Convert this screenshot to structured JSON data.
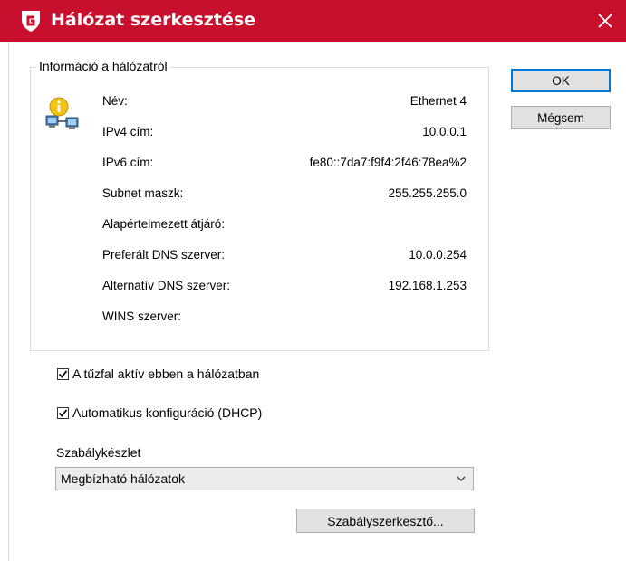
{
  "window": {
    "title": "Hálózat szerkesztése",
    "accent_color": "#c8102e",
    "logo_icon": "gdata-shield-icon",
    "close_icon": "close-icon"
  },
  "info_group": {
    "legend": "Információ a hálózatról",
    "icon": "network-info-icon",
    "rows": [
      {
        "label": "Név:",
        "value": "Ethernet 4"
      },
      {
        "label": "IPv4 cím:",
        "value": "10.0.0.1"
      },
      {
        "label": "IPv6 cím:",
        "value": "fe80::7da7:f9f4:2f46:78ea%2"
      },
      {
        "label": "Subnet maszk:",
        "value": "255.255.255.0"
      },
      {
        "label": "Alapértelmezett átjáró:",
        "value": ""
      },
      {
        "label": "Preferált DNS szerver:",
        "value": "10.0.0.254"
      },
      {
        "label": "Alternatív DNS szerver:",
        "value": "192.168.1.253"
      },
      {
        "label": "WINS szerver:",
        "value": ""
      }
    ]
  },
  "buttons": {
    "ok": "OK",
    "cancel": "Mégsem",
    "rule_editor": "Szabályszerkesztő..."
  },
  "checkboxes": {
    "firewall": {
      "label": "A tűzfal aktív ebben a hálózatban",
      "checked": true
    },
    "dhcp": {
      "label": "Automatikus konfiguráció (DHCP)",
      "checked": true
    }
  },
  "ruleset": {
    "label": "Szabálykészlet",
    "selected": "Megbízható hálózatok"
  }
}
